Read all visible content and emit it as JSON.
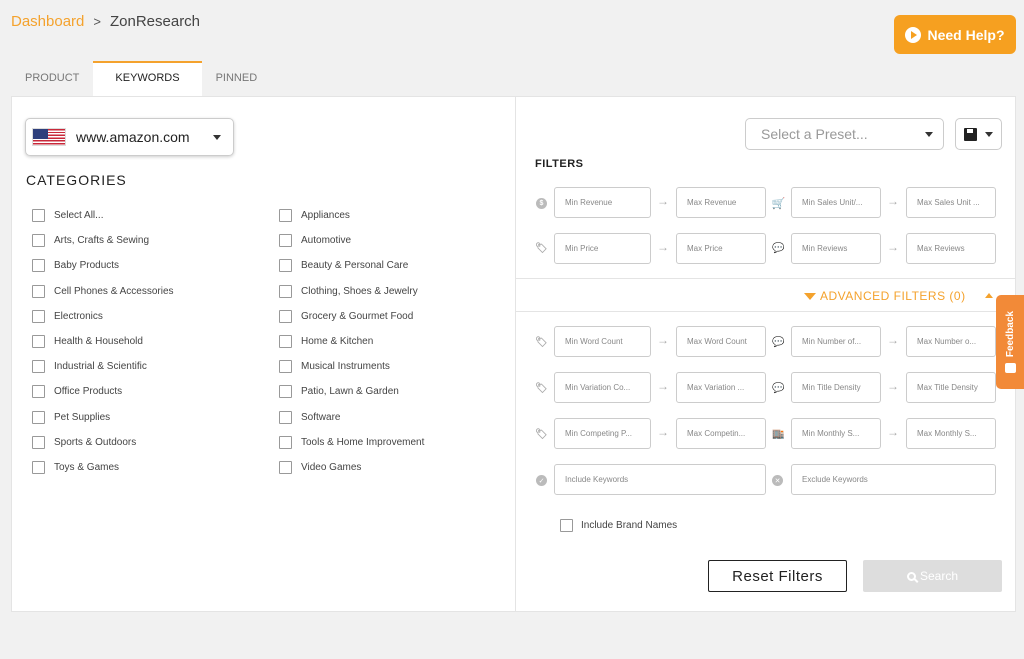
{
  "breadcrumb": {
    "parent": "Dashboard",
    "separator": ">",
    "current": "ZonResearch"
  },
  "help_button": {
    "label": "Need Help?",
    "icon": "play-circle-icon"
  },
  "tabs": [
    {
      "label": "PRODUCT",
      "active": false
    },
    {
      "label": "KEYWORDS",
      "active": true
    },
    {
      "label": "PINNED",
      "active": false
    }
  ],
  "marketplace": {
    "value": "www.amazon.com",
    "flag": "us-flag-icon"
  },
  "categories": {
    "title": "CATEGORIES",
    "left": [
      "Select All...",
      "Arts, Crafts & Sewing",
      "Baby Products",
      "Cell Phones & Accessories",
      "Electronics",
      "Health & Household",
      "Industrial & Scientific",
      "Office Products",
      "Pet Supplies",
      "Sports & Outdoors",
      "Toys & Games"
    ],
    "right": [
      "Appliances",
      "Automotive",
      "Beauty & Personal Care",
      "Clothing, Shoes & Jewelry",
      "Grocery & Gourmet Food",
      "Home & Kitchen",
      "Musical Instruments",
      "Patio, Lawn & Garden",
      "Software",
      "Tools & Home Improvement",
      "Video Games"
    ]
  },
  "preset": {
    "placeholder": "Select a Preset..."
  },
  "filters": {
    "title": "FILTERS",
    "min_revenue": "Min Revenue",
    "max_revenue": "Max Revenue",
    "min_sales_units": "Min Sales Unit/...",
    "max_sales_units": "Max Sales Unit ...",
    "min_price": "Min Price",
    "max_price": "Max Price",
    "min_reviews": "Min Reviews",
    "max_reviews": "Max Reviews"
  },
  "advanced": {
    "label": "ADVANCED FILTERS (0)",
    "min_word_count": "Min Word Count",
    "max_word_count": "Max Word Count",
    "min_number_of": "Min Number of...",
    "max_number_of": "Max Number o...",
    "min_variation": "Min Variation Co...",
    "max_variation": "Max Variation ...",
    "min_title_density": "Min Title Density",
    "max_title_density": "Max Title Density",
    "min_competing": "Min Competing P...",
    "max_competing": "Max Competin...",
    "min_monthly": "Min Monthly S...",
    "max_monthly": "Max Monthly S...",
    "include_keywords": "Include Keywords",
    "exclude_keywords": "Exclude Keywords",
    "include_brand_names": "Include Brand Names"
  },
  "actions": {
    "reset": "Reset Filters",
    "search": "Search"
  },
  "feedback": {
    "label": "Feedback"
  },
  "colors": {
    "accent": "#f4a22d",
    "help_bg": "#f6a020",
    "feedback_bg": "#f28a38"
  }
}
